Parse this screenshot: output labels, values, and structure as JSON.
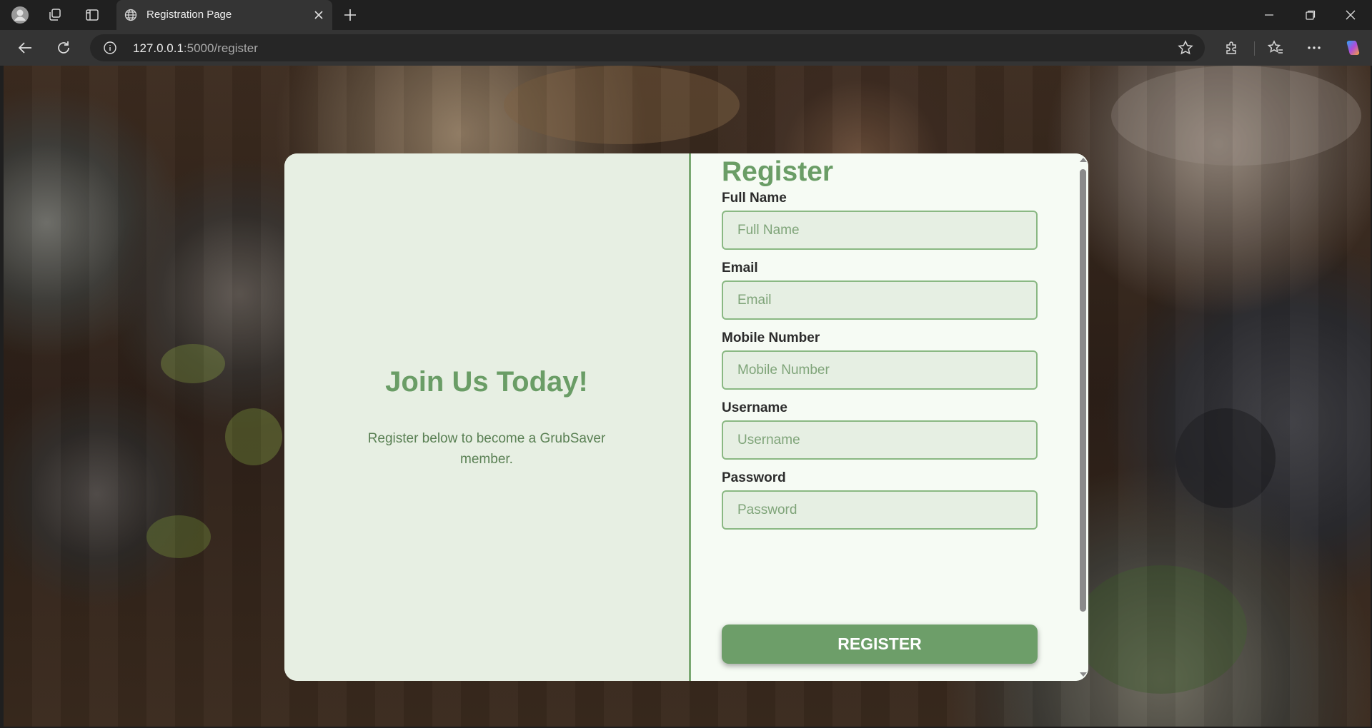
{
  "browser": {
    "tab_title": "Registration Page",
    "url_host": "127.0.0.1",
    "url_path": ":5000/register"
  },
  "panel": {
    "heading": "Join Us Today!",
    "subtext": "Register below to become a GrubSaver member."
  },
  "form": {
    "title": "Register",
    "fields": [
      {
        "label": "Full Name",
        "placeholder": "Full Name"
      },
      {
        "label": "Email",
        "placeholder": "Email"
      },
      {
        "label": "Mobile Number",
        "placeholder": "Mobile Number"
      },
      {
        "label": "Username",
        "placeholder": "Username"
      },
      {
        "label": "Password",
        "placeholder": "Password"
      }
    ],
    "submit_label": "REGISTER"
  },
  "colors": {
    "accent": "#6d9e69",
    "panel_bg": "#e7efe3",
    "form_bg": "#f6fbf4"
  },
  "icons": {
    "profile": "profile-avatar-icon",
    "workspaces": "workspaces-icon",
    "vertical_tabs": "vertical-tabs-icon",
    "tab_favicon": "globe-icon",
    "tab_close": "close-icon",
    "new_tab": "plus-icon",
    "back": "back-arrow-icon",
    "refresh": "refresh-icon",
    "site_info": "info-icon",
    "favorite": "star-icon",
    "extensions": "puzzle-icon",
    "favorites": "favorites-icon",
    "menu": "more-icon",
    "copilot": "copilot-icon"
  }
}
